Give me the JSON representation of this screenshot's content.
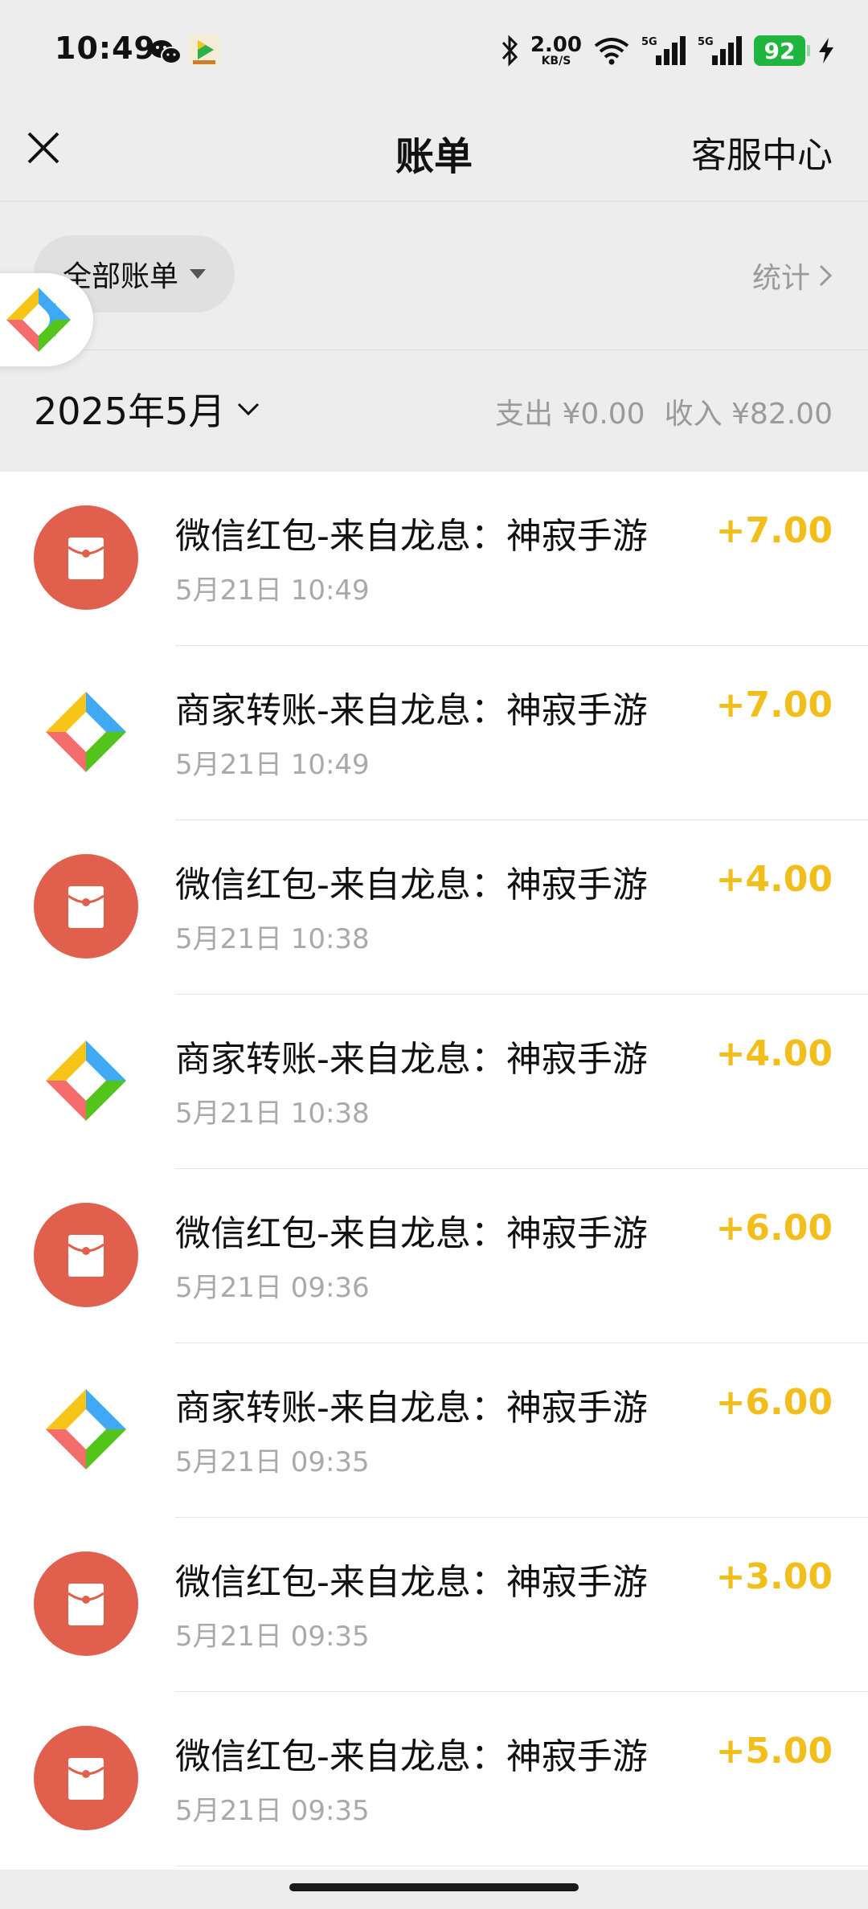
{
  "status_bar": {
    "time": "10:49",
    "net_speed": "2.00",
    "net_speed_unit": "KB/S",
    "battery": "92",
    "signal_1": "5G",
    "signal_2": "5G"
  },
  "header": {
    "title": "账单",
    "service": "客服中心"
  },
  "filter": {
    "label": "全部账单",
    "stats": "统计"
  },
  "month": {
    "label": "2025年5月",
    "expense": "支出 ¥0.00",
    "income": "收入 ¥82.00"
  },
  "transactions": [
    {
      "title": "微信红包-来自龙息：神寂手游",
      "time": "5月21日 10:49",
      "amount": "+7.00",
      "icon": "red-packet-icon"
    },
    {
      "title": "商家转账-来自龙息：神寂手游",
      "time": "5月21日 10:49",
      "amount": "+7.00",
      "icon": "merchant-transfer-icon"
    },
    {
      "title": "微信红包-来自龙息：神寂手游",
      "time": "5月21日 10:38",
      "amount": "+4.00",
      "icon": "red-packet-icon"
    },
    {
      "title": "商家转账-来自龙息：神寂手游",
      "time": "5月21日 10:38",
      "amount": "+4.00",
      "icon": "merchant-transfer-icon"
    },
    {
      "title": "微信红包-来自龙息：神寂手游",
      "time": "5月21日 09:36",
      "amount": "+6.00",
      "icon": "red-packet-icon"
    },
    {
      "title": "商家转账-来自龙息：神寂手游",
      "time": "5月21日 09:35",
      "amount": "+6.00",
      "icon": "merchant-transfer-icon"
    },
    {
      "title": "微信红包-来自龙息：神寂手游",
      "time": "5月21日 09:35",
      "amount": "+3.00",
      "icon": "red-packet-icon"
    },
    {
      "title": "微信红包-来自龙息：神寂手游",
      "time": "5月21日 09:35",
      "amount": "+5.00",
      "icon": "red-packet-icon"
    }
  ],
  "colors": {
    "amount": "#f1be1c",
    "red_packet": "#e0604d",
    "background": "#ededed"
  }
}
